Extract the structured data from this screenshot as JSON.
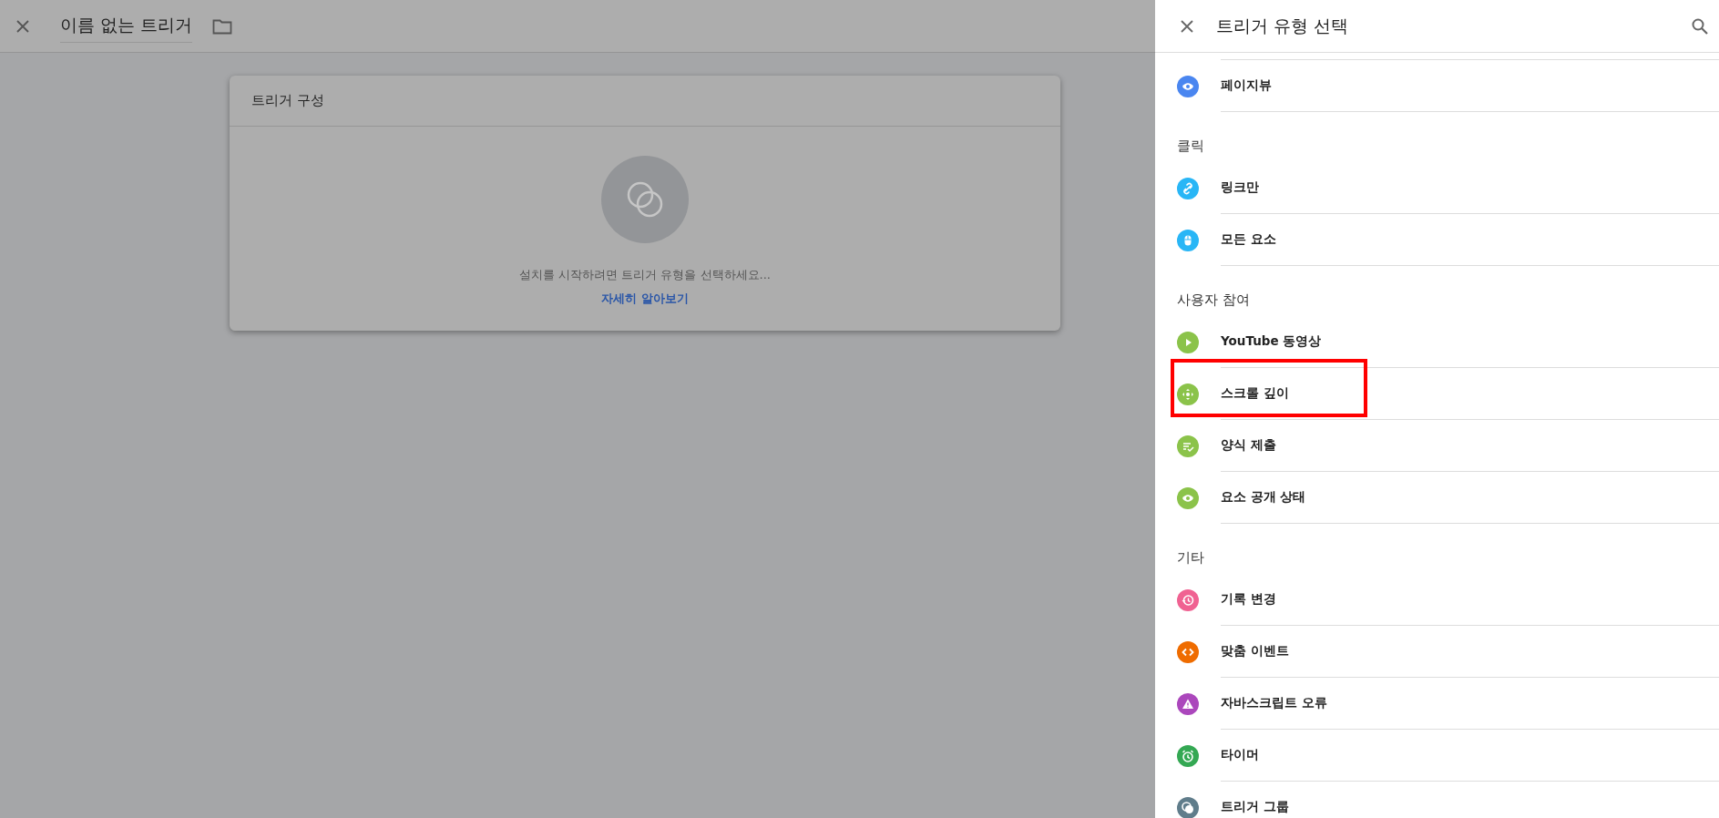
{
  "header": {
    "title": "이름 없는 트리거"
  },
  "card": {
    "title": "트리거 구성",
    "message": "설치를 시작하려면 트리거 유형을 선택하세요...",
    "link": "자세히 알아보기"
  },
  "panel": {
    "title": "트리거 유형 선택",
    "sections": [
      {
        "items": [
          {
            "label": "페이지뷰",
            "kind": "pageview",
            "color": "#4a86f0",
            "highlighted": false
          }
        ]
      },
      {
        "heading": "클릭",
        "items": [
          {
            "label": "링크만",
            "kind": "link",
            "color": "#29b6f6",
            "highlighted": false
          },
          {
            "label": "모든 요소",
            "kind": "click",
            "color": "#29b6f6",
            "highlighted": false
          }
        ]
      },
      {
        "heading": "사용자 참여",
        "items": [
          {
            "label": "YouTube 동영상",
            "kind": "video",
            "color": "#8bc34a",
            "highlighted": false
          },
          {
            "label": "스크롤 깊이",
            "kind": "scroll",
            "color": "#8bc34a",
            "highlighted": true
          },
          {
            "label": "양식 제출",
            "kind": "form",
            "color": "#8bc34a",
            "highlighted": false
          },
          {
            "label": "요소 공개 상태",
            "kind": "visibility",
            "color": "#8bc34a",
            "highlighted": false
          }
        ]
      },
      {
        "heading": "기타",
        "items": [
          {
            "label": "기록 변경",
            "kind": "history",
            "color": "#f06292",
            "highlighted": false
          },
          {
            "label": "맞춤 이벤트",
            "kind": "custom",
            "color": "#ef6c00",
            "highlighted": false
          },
          {
            "label": "자바스크립트 오류",
            "kind": "error",
            "color": "#ab47bc",
            "highlighted": false
          },
          {
            "label": "타이머",
            "kind": "timer",
            "color": "#34a853",
            "highlighted": false
          },
          {
            "label": "트리거 그룹",
            "kind": "group",
            "color": "#607d8b",
            "highlighted": false
          }
        ]
      }
    ]
  }
}
